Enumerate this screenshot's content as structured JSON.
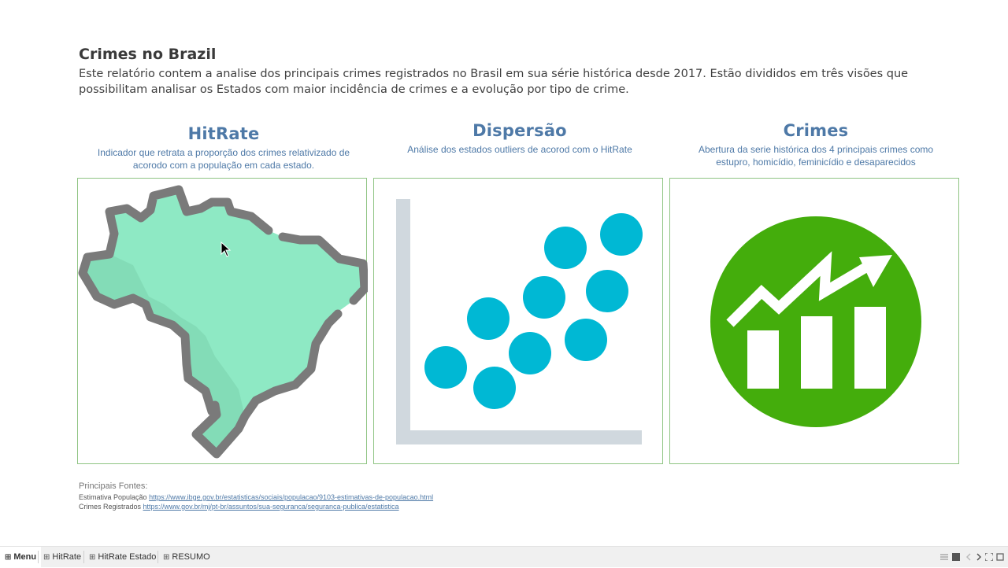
{
  "header": {
    "title": "Crimes no Brazil",
    "intro": "Este relatório contem a analise dos principais crimes registrados no Brasil em sua série histórica desde 2017. Estão divididos em três visões que possibilitam analisar os Estados com maior incidência de crimes e a evolução por tipo de crime."
  },
  "cards": [
    {
      "title": "HitRate",
      "description": "Indicador que retrata a proporção dos crimes relativizado de acorodo com a população em cada estado.",
      "icon": "brazil-map-icon"
    },
    {
      "title": "Dispersão",
      "description": "Análise dos estados outliers de acorod com o HitRate",
      "icon": "scatter-plot-icon"
    },
    {
      "title": "Crimes",
      "description": "Abertura da serie histórica dos 4 principais crimes como estupro, homicídio, feminicídio e desaparecidos",
      "icon": "growth-chart-icon"
    }
  ],
  "sources": {
    "label": "Principais Fontes:",
    "items": [
      {
        "name": "Estimativa População",
        "url": "https://www.ibge.gov.br/estatisticas/sociais/populacao/9103-estimativas-de-populacao.html"
      },
      {
        "name": "Crimes Registrados",
        "url": "https://www.gov.br/mj/pt-br/assuntos/sua-seguranca/seguranca-publica/estatistica"
      }
    ]
  },
  "tabs": [
    {
      "label": "Menu",
      "active": true
    },
    {
      "label": "HitRate",
      "active": false
    },
    {
      "label": "HitRate Estado",
      "active": false
    },
    {
      "label": "RESUMO",
      "active": false
    }
  ],
  "colors": {
    "accent": "#4e79a7",
    "card_border": "#8fc483",
    "map_fill": "#8ee9c4",
    "map_outline": "#7a7a7a",
    "scatter_dot": "#00b8d4",
    "axis": "#d0d8de",
    "growth_circle": "#44ad0c"
  }
}
